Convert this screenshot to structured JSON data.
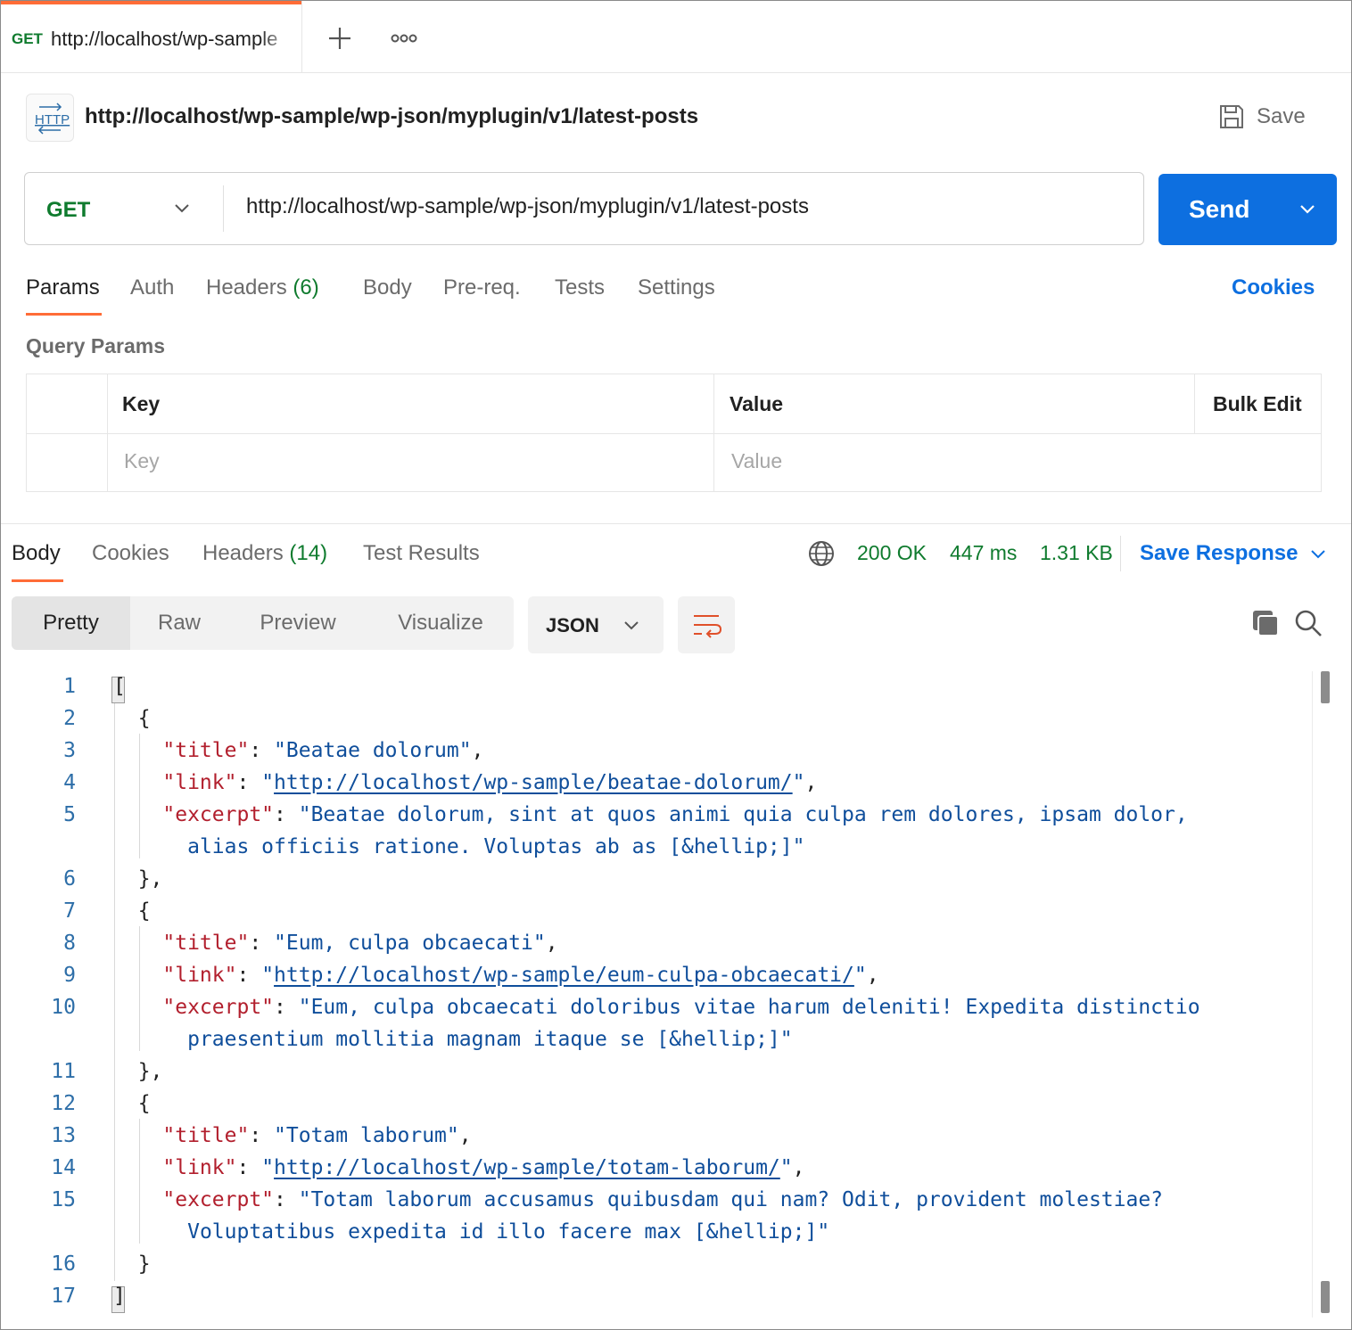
{
  "tabs": [
    {
      "method": "GET",
      "title": "http://localhost/wp-sample"
    }
  ],
  "request": {
    "title": "http://localhost/wp-sample/wp-json/myplugin/v1/latest-posts",
    "save_label": "Save",
    "method": "GET",
    "url": "http://localhost/wp-sample/wp-json/myplugin/v1/latest-posts",
    "send_label": "Send"
  },
  "request_tabs": {
    "params": "Params",
    "auth": "Auth",
    "headers": "Headers",
    "headers_count": "(6)",
    "body": "Body",
    "prereq": "Pre-req.",
    "tests": "Tests",
    "settings": "Settings",
    "cookies": "Cookies"
  },
  "query_params": {
    "title": "Query Params",
    "key_header": "Key",
    "value_header": "Value",
    "bulk_edit": "Bulk Edit",
    "key_placeholder": "Key",
    "value_placeholder": "Value"
  },
  "response_tabs": {
    "body": "Body",
    "cookies": "Cookies",
    "headers": "Headers",
    "headers_count": "(14)",
    "test_results": "Test Results"
  },
  "response_status": {
    "status": "200 OK",
    "time": "447 ms",
    "size": "1.31 KB",
    "save_response": "Save Response"
  },
  "view_modes": [
    "Pretty",
    "Raw",
    "Preview",
    "Visualize"
  ],
  "format": "JSON",
  "json_body": {
    "line_numbers": [
      "1",
      "2",
      "3",
      "4",
      "5",
      "6",
      "7",
      "8",
      "9",
      "10",
      "11",
      "12",
      "13",
      "14",
      "15",
      "16",
      "17"
    ],
    "posts": [
      {
        "title": "Beatae dolorum",
        "link": "http://localhost/wp-sample/beatae-dolorum/",
        "excerpt_1": "Beatae dolorum, sint at quos animi quia culpa rem dolores, ipsam dolor,",
        "excerpt_2": "alias officiis ratione. Voluptas ab as [&hellip;]"
      },
      {
        "title": "Eum, culpa obcaecati",
        "link": "http://localhost/wp-sample/eum-culpa-obcaecati/",
        "excerpt_1": "Eum, culpa obcaecati doloribus vitae harum deleniti! Expedita distinctio",
        "excerpt_2": "praesentium mollitia magnam itaque se [&hellip;]"
      },
      {
        "title": "Totam laborum",
        "link": "http://localhost/wp-sample/totam-laborum/",
        "excerpt_1": "Totam laborum accusamus quibusdam qui nam? Odit, provident molestiae?",
        "excerpt_2": "Voluptatibus expedita id illo facere max [&hellip;]"
      }
    ]
  },
  "colors": {
    "accent": "#ff6c37",
    "send": "#0d6fe0",
    "method_get": "#0f7b2e",
    "json_key": "#b21f2d",
    "json_string": "#0f4e9b"
  }
}
